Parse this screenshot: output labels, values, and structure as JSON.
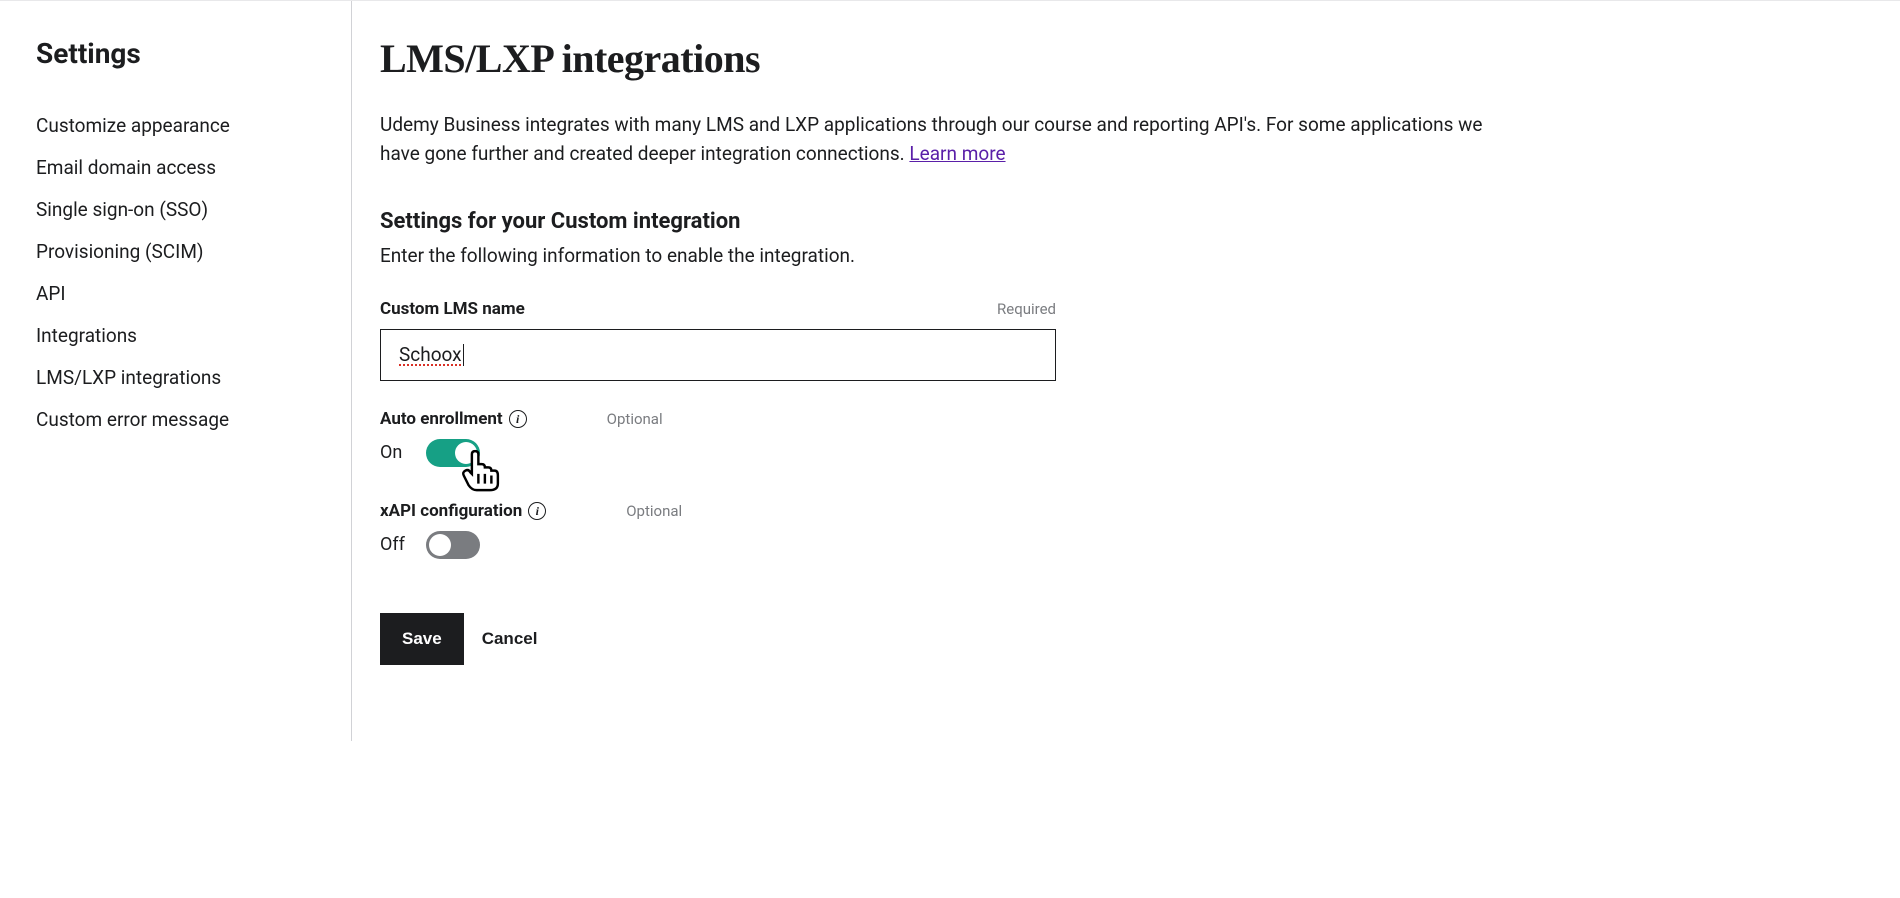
{
  "sidebar": {
    "title": "Settings",
    "items": [
      "Customize appearance",
      "Email domain access",
      "Single sign-on (SSO)",
      "Provisioning (SCIM)",
      "API",
      "Integrations",
      "LMS/LXP integrations",
      "Custom error message"
    ]
  },
  "main": {
    "title": "LMS/LXP integrations",
    "intro_text": "Udemy Business integrates with many LMS and LXP applications through our course and reporting API's. For some applications we have gone further and created deeper integration connections. ",
    "learn_more": "Learn more",
    "subsection_title": "Settings for your Custom integration",
    "subsection_desc": "Enter the following information to enable the integration.",
    "lms_name_label": "Custom LMS name",
    "required_text": "Required",
    "lms_name_value": "Schoox",
    "auto_enroll_label": "Auto enrollment",
    "optional_text": "Optional",
    "auto_enroll_state": "On",
    "xapi_label": "xAPI configuration",
    "xapi_state": "Off",
    "save_label": "Save",
    "cancel_label": "Cancel"
  }
}
